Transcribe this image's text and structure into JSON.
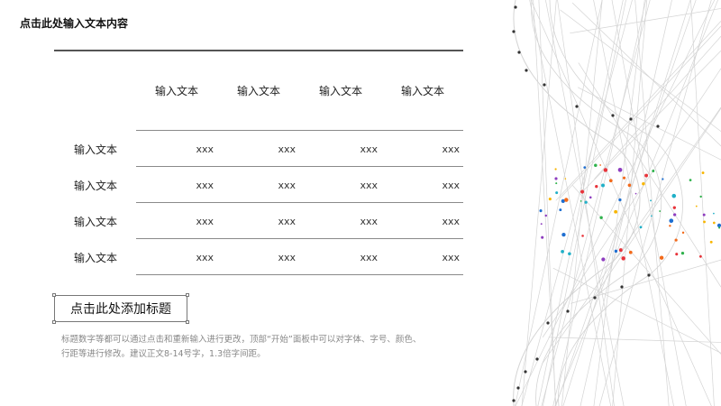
{
  "page": {
    "title": "点击此处输入文本内容",
    "subtitle": "点击此处添加标题",
    "body_lines": [
      "标题数字等都可以通过点击和重新输入进行更改，顶部“开始”面板中可以对字体、字号、颜色、",
      "行距等进行修改。建议正文8-14号字，1.3倍字间距。"
    ]
  },
  "table": {
    "columns": [
      "输入文本",
      "输入文本",
      "输入文本",
      "输入文本"
    ],
    "rows": [
      {
        "label": "输入文本",
        "cells": [
          "xxx",
          "xxx",
          "xxx",
          "xxx"
        ]
      },
      {
        "label": "输入文本",
        "cells": [
          "xxx",
          "xxx",
          "xxx",
          "xxx"
        ]
      },
      {
        "label": "输入文本",
        "cells": [
          "xxx",
          "xxx",
          "xxx",
          "xxx"
        ]
      },
      {
        "label": "输入文本",
        "cells": [
          "xxx",
          "xxx",
          "xxx",
          "xxx"
        ]
      }
    ]
  },
  "decor": {
    "line_color": "#d4d4d4",
    "node_color": "#333333",
    "particle_colors": [
      "#e8333a",
      "#f7b500",
      "#2fb24c",
      "#1f6fd1",
      "#8e3dbf",
      "#20b0c8",
      "#f26a1b"
    ]
  }
}
